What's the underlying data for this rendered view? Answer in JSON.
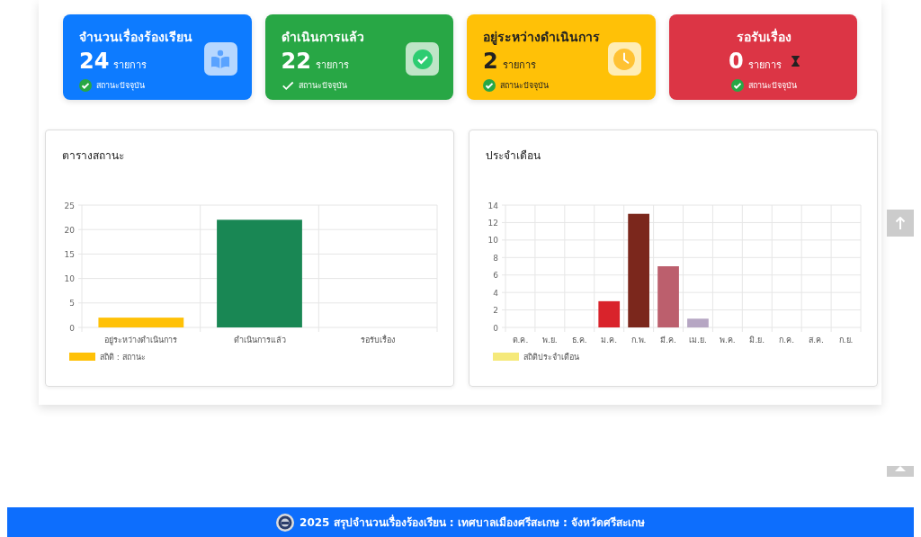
{
  "cards": [
    {
      "title": "จำนวนเรื่องร้องเรียน",
      "count": "24",
      "unit": "รายการ",
      "status": "สถานะปัจจุบัน",
      "color": "#0d7bff",
      "kind": "book",
      "status_circle": true,
      "centered": false,
      "dark_text": false
    },
    {
      "title": "ดำเนินการแล้ว",
      "count": "22",
      "unit": "รายการ",
      "status": "สถานะปัจจุบัน",
      "color": "#28a745",
      "kind": "check",
      "status_circle": false,
      "centered": false,
      "dark_text": false
    },
    {
      "title": "อยู่ระหว่างดำเนินการ",
      "count": "2",
      "unit": "รายการ",
      "status": "สถานะปัจจุบัน",
      "color": "#ffc107",
      "kind": "clock",
      "status_circle": true,
      "centered": false,
      "dark_text": true
    },
    {
      "title": "รอรับเรื่อง",
      "count": "0",
      "unit": "รายการ",
      "status": "สถานะปัจจุบัน",
      "color": "#dc3545",
      "kind": "hourglass",
      "status_circle": true,
      "centered": true,
      "dark_text": false
    }
  ],
  "charts": [
    {
      "title": "ตารางสถานะ",
      "legend": {
        "color": "#ffc107"
      },
      "bars": [
        {
          "color": "#ffc107"
        },
        {
          "color": "#198754"
        }
      ],
      "chart_data": {
        "type": "bar",
        "grid": true,
        "categories": [
          "อยู่ระหว่างดำเนินการ",
          "ดำเนินการแล้ว",
          "รอรับเรื่อง"
        ],
        "series": [
          {
            "name": "สถิติ : สถานะ",
            "values": [
              2,
              22,
              0
            ]
          }
        ],
        "ylim": [
          0,
          25
        ],
        "yticks": [
          0,
          5,
          10,
          15,
          20,
          25
        ]
      }
    },
    {
      "title": "ประจำเดือน",
      "legend": {
        "color": "#f5e97a"
      },
      "bars": [
        {
          "color": "#d9232b"
        },
        {
          "color": "#7b271c"
        },
        {
          "color": "#bc5f6d"
        },
        {
          "color": "#b6a6c3"
        }
      ],
      "chart_data": {
        "type": "bar",
        "grid": true,
        "categories": [
          "ต.ค.",
          "พ.ย.",
          "ธ.ค.",
          "ม.ค.",
          "ก.พ.",
          "มี.ค.",
          "เม.ย.",
          "พ.ค.",
          "มิ.ย.",
          "ก.ค.",
          "ส.ค.",
          "ก.ย."
        ],
        "series": [
          {
            "name": "สถิติประจำเดือน",
            "values": [
              0,
              0,
              0,
              3,
              13,
              7,
              1,
              0,
              0,
              0,
              0,
              0
            ]
          }
        ],
        "ylim": [
          0,
          14
        ],
        "yticks": [
          0,
          2,
          4,
          6,
          8,
          10,
          12,
          14
        ]
      }
    }
  ],
  "footer": {
    "text": "2025 สรุปจำนวนเรื่องร้องเรียน : เทศบาลเมืองศรีสะเกษ : จังหวัดศรีสะเกษ"
  }
}
